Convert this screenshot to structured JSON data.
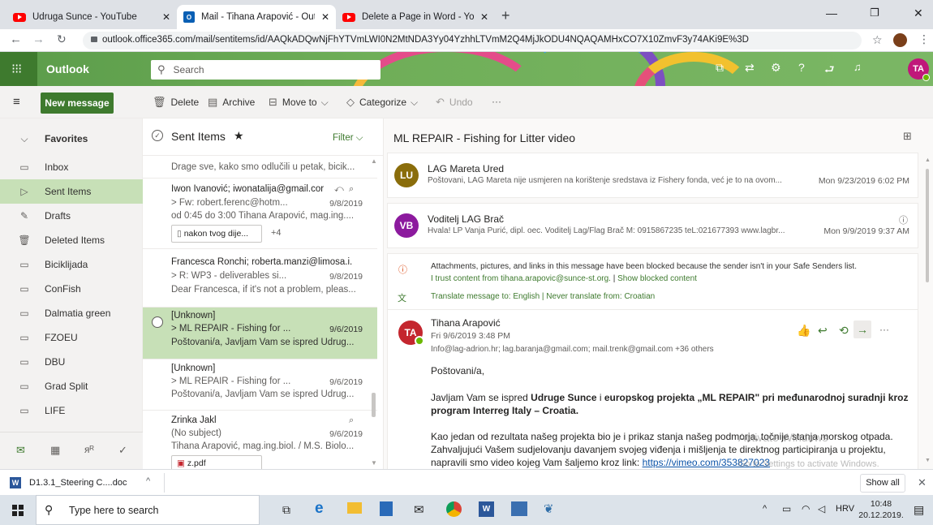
{
  "browser": {
    "tabs": [
      {
        "title": "Udruga Sunce - YouTube",
        "icon": "youtube-icon"
      },
      {
        "title": "Mail - Tihana Arapović - Outlook",
        "icon": "outlook-icon"
      },
      {
        "title": "Delete a Page in Word - YouTube",
        "icon": "youtube-icon"
      }
    ],
    "url": "outlook.office365.com/mail/sentitems/id/AAQkADQwNjFhYTVmLWI0N2MtNDA3Yy04YzhhLTVmM2Q4MjJkODU4NQAQAMHxCO7X10ZmvF3y74AKi9E%3D"
  },
  "header": {
    "app_name": "Outlook",
    "search_placeholder": "Search",
    "avatar_initials": "TA",
    "brand_color": "#5b9c4a"
  },
  "toolbar": {
    "new_message": "New message",
    "delete": "Delete",
    "archive": "Archive",
    "move_to": "Move to",
    "categorize": "Categorize",
    "undo": "Undo",
    "more": "···"
  },
  "nav": {
    "favorites": "Favorites",
    "items": [
      {
        "label": "Inbox",
        "icon": "inbox-icon",
        "glyph": "▭"
      },
      {
        "label": "Sent Items",
        "icon": "send-icon",
        "glyph": "▷"
      },
      {
        "label": "Drafts",
        "icon": "pencil-icon",
        "glyph": "✎"
      },
      {
        "label": "Deleted Items",
        "icon": "trash-icon",
        "glyph": "🗑"
      },
      {
        "label": "Biciklijada",
        "icon": "folder-icon",
        "glyph": "▭"
      },
      {
        "label": "ConFish",
        "icon": "folder-icon",
        "glyph": "▭"
      },
      {
        "label": "Dalmatia green",
        "icon": "folder-icon",
        "glyph": "▭"
      },
      {
        "label": "FZOEU",
        "icon": "folder-icon",
        "glyph": "▭"
      },
      {
        "label": "DBU",
        "icon": "folder-icon",
        "glyph": "▭"
      },
      {
        "label": "Grad Split",
        "icon": "folder-icon",
        "glyph": "▭"
      },
      {
        "label": "LIFE",
        "icon": "folder-icon",
        "glyph": "▭"
      }
    ]
  },
  "list": {
    "title": "Sent Items",
    "filter": "Filter",
    "top_preview": "Drage sve, kako smo odlučili u petak, bicik...",
    "messages": [
      {
        "from": "Iwon Ivanović; iwonatalija@gmail.cor",
        "subject": "> Fw: robert.ferenc@hotm...",
        "date": "9/8/2019",
        "preview": "od 0:45 do 3:00 Tihana Arapović, mag.ing....",
        "attachment": "nakon tvog dije...",
        "more": "+4"
      },
      {
        "from": "Francesca Ronchi; roberta.manzi@limosa.i.",
        "subject": "> R: WP3 - deliverables si...",
        "date": "9/8/2019",
        "preview": "Dear Francesca, if it's not a problem, pleas..."
      },
      {
        "from": "[Unknown]",
        "subject": "> ML REPAIR - Fishing for ...",
        "date": "9/6/2019",
        "preview": "Poštovani/a, Javljam Vam se ispred Udrug..."
      },
      {
        "from": "[Unknown]",
        "subject": "> ML REPAIR - Fishing for ...",
        "date": "9/6/2019",
        "preview": "Poštovani/a, Javljam Vam se ispred Udrug..."
      },
      {
        "from": "Zrinka Jakl",
        "subject": "(No subject)",
        "date": "9/6/2019",
        "preview": "Tihana Arapović, mag.ing.biol. / M.S. Biolo...",
        "attachment": "z.pdf"
      }
    ]
  },
  "reading": {
    "subject": "ML REPAIR - Fishing for Litter video",
    "thread": [
      {
        "initials": "LU",
        "color": "#8a6d0b",
        "from": "LAG Mareta Ured",
        "snippet": "Poštovani, LAG Mareta nije usmjeren na korištenje sredstava iz Fishery fonda, već je to na ovom...",
        "date": "Mon 9/23/2019 6:02 PM"
      },
      {
        "initials": "VB",
        "color": "#8c1a9e",
        "from": "Voditelj LAG Brač",
        "snippet": "Hvala! LP Vanja Purić, dipl. oec. Voditelj Lag/Flag Brač M: 0915867235 teL:021677393 www.lagbr...",
        "date": "Mon 9/9/2019 9:37 AM"
      }
    ],
    "blocked_notice": "Attachments, pictures, and links in this message have been blocked because the sender isn't in your Safe Senders list.",
    "trust_link": "I trust content from tihana.arapovic@sunce-st.org.",
    "separator": "|",
    "show_blocked": "Show blocked content",
    "translate": "Translate message to: English | Never translate from: Croatian",
    "message": {
      "initials": "TA",
      "color": "#c4262e",
      "from": "Tihana Arapović",
      "date": "Fri 9/6/2019 3:48 PM",
      "to": "Info@lag-adrion.hr; lag.baranja@gmail.com; mail.trenk@gmail.com +36 others",
      "greeting": "Poštovani/a,",
      "p1_a": "Javljam Vam se ispred ",
      "p1_b": "Udruge Sunce",
      "p1_c": " i ",
      "p1_d": "europskog projekta „ML REPAIR\" pri međunarodnoj suradnji kroz program Interreg Italy – Croatia.",
      "p2_line1": "Kao jedan od rezultata našeg projekta bio je i prikaz stanja našeg podmorja, točnije stanja morskog otpada.",
      "p2_line2": "Zahvaljujući Vašem sudjelovanju davanjem svojeg viđenja i mišljenja te direktnog participiranja u projektu,",
      "p2_line3": "napravili smo video kojeg Vam šaljemo kroz link: ",
      "link": "https://vimeo.com/353827023"
    },
    "watermark_1": "Activate Windows",
    "watermark_2": "Go to Settings to activate Windows."
  },
  "downloads": {
    "file": "D1.3.1_Steering C....doc",
    "show_all": "Show all"
  },
  "taskbar": {
    "search": "Type here to search",
    "lang": "HRV",
    "time": "10:48",
    "date": "20.12.2019."
  }
}
